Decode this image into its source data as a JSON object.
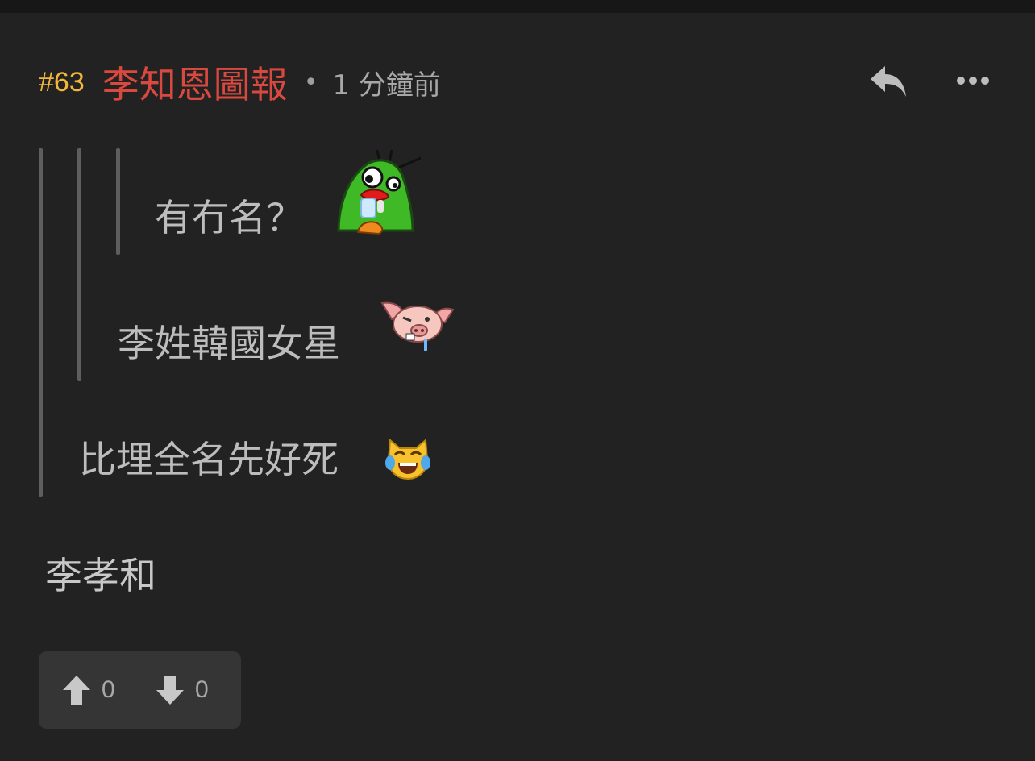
{
  "post": {
    "number": "#63",
    "author": "李知恩圖報",
    "separator": "•",
    "time": "1 分鐘前"
  },
  "quotes": [
    {
      "level": 3,
      "text": "有冇名？",
      "sticker": "green-parrot-sticker"
    },
    {
      "level": 2,
      "text": "李姓韓國女星",
      "sticker": "pig-sticker"
    },
    {
      "level": 1,
      "text": "比埋全名先好死",
      "sticker": "cat-tears-of-joy-emoji"
    }
  ],
  "reply_text": "李孝和",
  "votes": {
    "up": "0",
    "down": "0"
  },
  "icons": {
    "reply": "reply-icon",
    "more": "more-options-icon",
    "up": "arrow-up-icon",
    "down": "arrow-down-icon"
  },
  "colors": {
    "background": "#222222",
    "post_number": "#f2b73a",
    "author": "#d9493f",
    "text": "#bdbdbd",
    "vote_box": "#353535"
  }
}
